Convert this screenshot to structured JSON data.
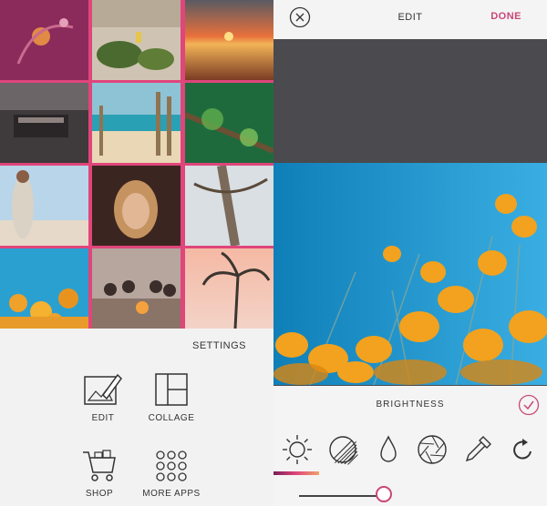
{
  "gallery": {
    "thumbnails": [
      {
        "name": "thumb-flower-purple"
      },
      {
        "name": "thumb-beach-palms"
      },
      {
        "name": "thumb-sunset-sea"
      },
      {
        "name": "thumb-bbq-grill"
      },
      {
        "name": "thumb-beach-fence"
      },
      {
        "name": "thumb-green-branch"
      },
      {
        "name": "thumb-woman-beach"
      },
      {
        "name": "thumb-girl-portrait"
      },
      {
        "name": "thumb-palm-trunk"
      },
      {
        "name": "thumb-yellow-flowers"
      },
      {
        "name": "thumb-campfire-friends"
      },
      {
        "name": "thumb-palm-sky"
      }
    ]
  },
  "home": {
    "settings_label": "SETTINGS",
    "apps": [
      {
        "label": "EDIT",
        "icon": "edit-icon"
      },
      {
        "label": "COLLAGE",
        "icon": "collage-icon"
      },
      {
        "label": "SHOP",
        "icon": "cart-icon"
      },
      {
        "label": "MORE APPS",
        "icon": "more-apps-icon"
      }
    ]
  },
  "editor": {
    "title": "EDIT",
    "done_label": "DONE",
    "tool_name": "BRIGHTNESS",
    "accent": "#c94677",
    "tools": [
      {
        "icon": "brightness-icon",
        "active": true
      },
      {
        "icon": "contrast-icon",
        "active": false
      },
      {
        "icon": "saturation-drop-icon",
        "active": false
      },
      {
        "icon": "aperture-icon",
        "active": false
      },
      {
        "icon": "eyedropper-icon",
        "active": false
      },
      {
        "icon": "rotate-icon",
        "active": false
      }
    ],
    "slider_value": 0.5
  }
}
